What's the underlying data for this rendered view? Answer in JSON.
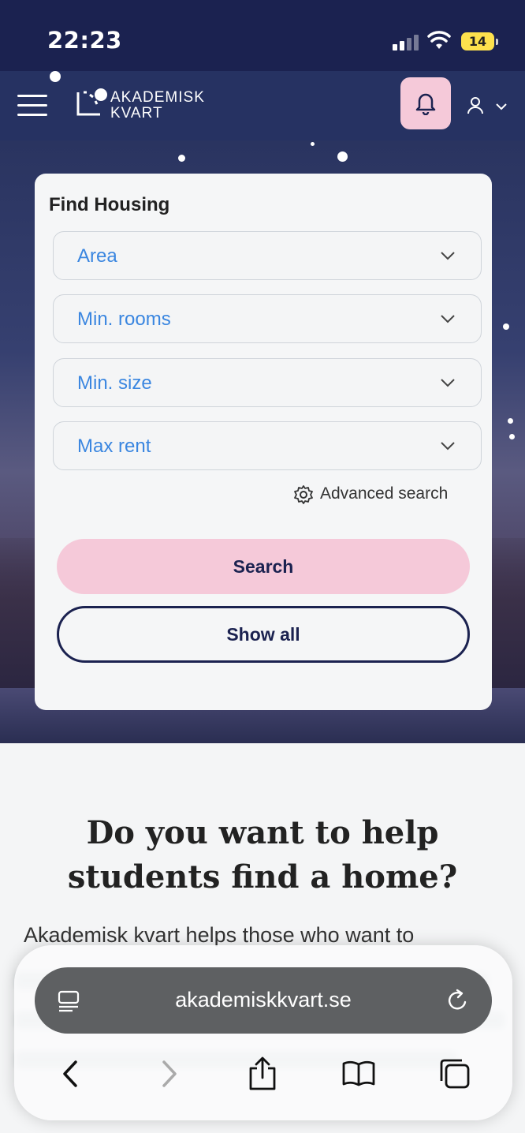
{
  "status_bar": {
    "time": "22:23",
    "battery": "14"
  },
  "nav": {
    "logo_line1": "AKADEMISK",
    "logo_line2": "KVART"
  },
  "search_card": {
    "title": "Find Housing",
    "selects": [
      "Area",
      "Min. rooms",
      "Min. size",
      "Max rent"
    ],
    "advanced_search": "Advanced search",
    "search_button": "Search",
    "show_all_button": "Show all"
  },
  "content": {
    "heading_line1": "Do you want to help",
    "heading_line2": "students find a home?",
    "paragraph": "Akademisk kvart helps those who want to"
  },
  "browser": {
    "url": "akademiskkvart.se"
  },
  "colors": {
    "accent_pink": "#f5c9d9",
    "navy": "#1b2250",
    "link_blue": "#3a86e0"
  }
}
